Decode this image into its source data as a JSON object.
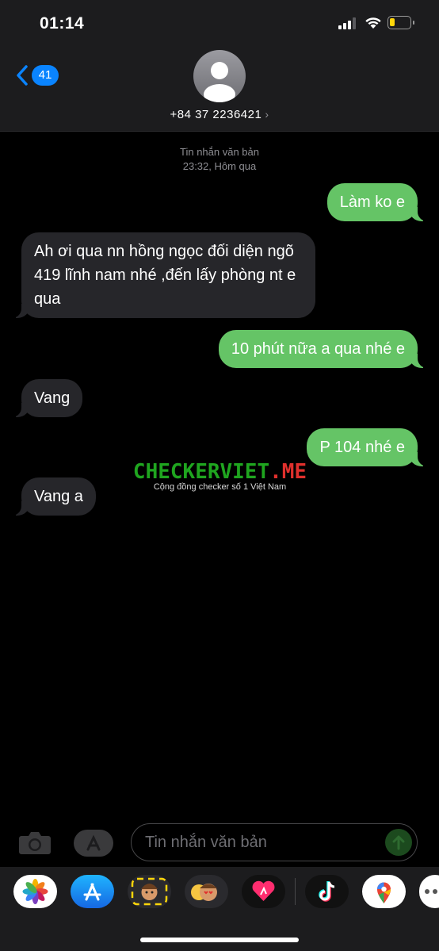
{
  "status_bar": {
    "time": "01:14",
    "battery_level": 0.25
  },
  "header": {
    "back_badge": "41",
    "contact": "+84 37 2236421",
    "contact_arrow": "›"
  },
  "conversation": {
    "meta_type": "Tin nhắn văn bản",
    "meta_time": "23:32, Hôm qua",
    "messages": [
      {
        "from": "me",
        "text": "Làm ko e"
      },
      {
        "from": "them",
        "text": "Ah ơi qua nn hồng ngọc  đối diện ngõ 419 lĩnh nam nhé ,đến lấy phòng nt e qua"
      },
      {
        "from": "me",
        "text": "10 phút nữa a qua nhé e"
      },
      {
        "from": "them",
        "text": "Vang"
      },
      {
        "from": "me",
        "text": "P 104 nhé e"
      },
      {
        "from": "them",
        "text": "Vang a"
      }
    ]
  },
  "watermark": {
    "brand_a": "CHECKERVIET",
    "brand_b": ".ME",
    "tagline": "Cộng đồng checker số 1 Việt Nam"
  },
  "composer": {
    "placeholder": "Tin nhắn văn bản"
  },
  "colors": {
    "outgoing": "#65c466",
    "incoming": "#26262a",
    "badge": "#0a84ff"
  },
  "app_drawer": [
    "photos-icon",
    "app-store-icon",
    "memoji-icon",
    "memoji-stickers-icon",
    "digital-touch-icon",
    "tiktok-icon",
    "google-maps-icon",
    "more-icon"
  ]
}
